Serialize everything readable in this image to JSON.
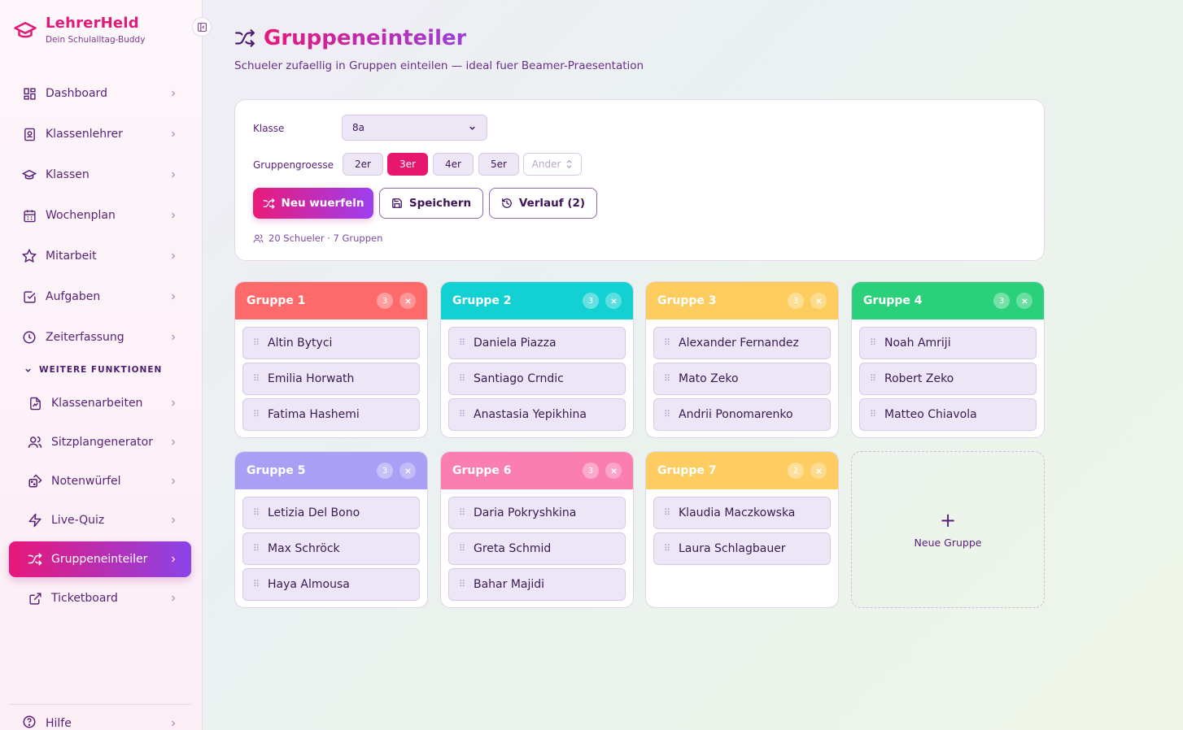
{
  "brand": {
    "name": "LehrerHeld",
    "tagline": "Dein Schulalltag-Buddy"
  },
  "sidebar": {
    "items": [
      {
        "label": "Dashboard",
        "icon": "grid-icon"
      },
      {
        "label": "Klassenlehrer",
        "icon": "contact-book-icon"
      },
      {
        "label": "Klassen",
        "icon": "graduation-cap-icon"
      },
      {
        "label": "Wochenplan",
        "icon": "calendar-icon"
      },
      {
        "label": "Mitarbeit",
        "icon": "star-icon"
      },
      {
        "label": "Aufgaben",
        "icon": "checkbox-icon"
      },
      {
        "label": "Zeiterfassung",
        "icon": "clock-icon"
      }
    ],
    "section_label": "WEITERE FUNKTIONEN",
    "sub_items": [
      {
        "label": "Klassenarbeiten",
        "icon": "file-signature-icon"
      },
      {
        "label": "Sitzplangenerator",
        "icon": "users-icon"
      },
      {
        "label": "Notenwürfel",
        "icon": "dice-icon"
      },
      {
        "label": "Live-Quiz",
        "icon": "zap-icon"
      },
      {
        "label": "Gruppeneinteiler",
        "icon": "shuffle-icon",
        "active": true
      },
      {
        "label": "Ticketboard",
        "icon": "external-link-icon"
      }
    ],
    "help_label": "Hilfe"
  },
  "page": {
    "title": "Gruppeneinteiler",
    "subtitle": "Schueler zufaellig in Gruppen einteilen — ideal fuer Beamer-Praesentation"
  },
  "controls": {
    "class_label": "Klasse",
    "class_value": "8a",
    "size_label": "Gruppengroesse",
    "sizes": [
      "2er",
      "3er",
      "4er",
      "5er"
    ],
    "selected_size": "3er",
    "other_size_label": "Ander",
    "reroll_label": "Neu wuerfeln",
    "save_label": "Speichern",
    "history_label": "Verlauf (2)",
    "stats": "20 Schueler · 7 Gruppen"
  },
  "colors": {
    "accent": "#e8176e",
    "group_1": "#fe6a6a",
    "group_2": "#13d1d3",
    "group_3": "#fccd5e",
    "group_4": "#2bd17a",
    "group_5": "#a9a0f5",
    "group_6": "#fb7eb0",
    "group_7": "#fdcd62"
  },
  "groups": [
    {
      "name": "Gruppe 1",
      "count": "3",
      "members": [
        "Altin Bytyci",
        "Emilia Horwath",
        "Fatima Hashemi"
      ]
    },
    {
      "name": "Gruppe 2",
      "count": "3",
      "members": [
        "Daniela Piazza",
        "Santiago Crndic",
        "Anastasia Yepikhina"
      ]
    },
    {
      "name": "Gruppe 3",
      "count": "3",
      "members": [
        "Alexander Fernandez",
        "Mato Zeko",
        "Andrii Ponomarenko"
      ]
    },
    {
      "name": "Gruppe 4",
      "count": "3",
      "members": [
        "Noah Amriji",
        "Robert Zeko",
        "Matteo Chiavola"
      ]
    },
    {
      "name": "Gruppe 5",
      "count": "3",
      "members": [
        "Letizia Del Bono",
        "Max Schröck",
        "Haya Almousa"
      ]
    },
    {
      "name": "Gruppe 6",
      "count": "3",
      "members": [
        "Daria Pokryshkina",
        "Greta Schmid",
        "Bahar Majidi"
      ]
    },
    {
      "name": "Gruppe 7",
      "count": "2",
      "members": [
        "Klaudia Maczkowska",
        "Laura Schlagbauer"
      ]
    }
  ],
  "new_group_label": "Neue Gruppe"
}
